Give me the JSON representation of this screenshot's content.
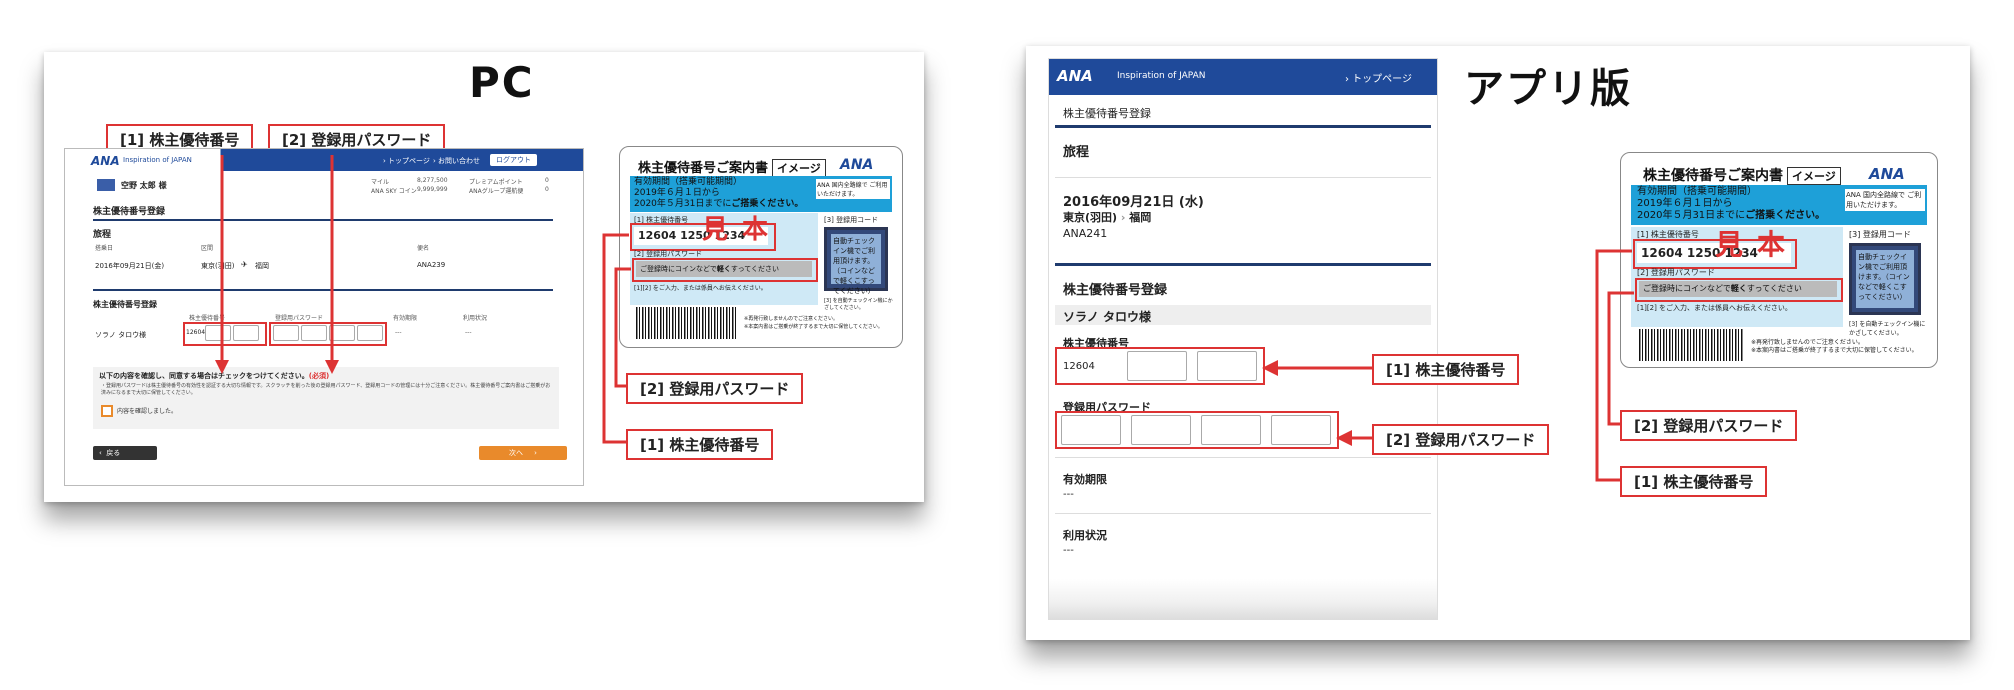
{
  "pc": {
    "title": "PC",
    "labels": {
      "label1": "[1] 株主優待番号",
      "label2": "[2] 登録用パスワード"
    },
    "screen": {
      "logo": "ANA",
      "logo_sub": "Inspiration of JAPAN",
      "nav_top": "› トップページ",
      "nav_contact": "› お問い合わせ",
      "logout": "ログアウト",
      "user_name": "空野 太郎 様",
      "miles_label": "マイル",
      "miles_value": "8,277,500",
      "premium_label": "プレミアムポイント",
      "premium_value": "0",
      "skycoin_label": "ANA SKY コイン",
      "skycoin_value": "9,999,999",
      "group_label": "ANAグループ運航便",
      "group_value": "0",
      "page_title": "株主優待番号登録",
      "itinerary_heading": "旅程",
      "col_date": "搭乗日",
      "col_route": "区間",
      "col_flight": "便名",
      "flight_date": "2016年09月21日(金)",
      "route_from": "東京(羽田)",
      "route_to": "福岡",
      "flight_no": "ANA239",
      "register_heading": "株主優待番号登録",
      "col_number": "株主優待番号",
      "col_password": "登録用パスワード",
      "col_expiry": "有効期限",
      "col_status": "利用状況",
      "passenger": "ソラノ タロウ様",
      "number_prefix": "12604",
      "expiry_value": "---",
      "status_value": "---",
      "confirm_heading": "以下の内容を確認し、同意する場合はチェックをつけてください。",
      "confirm_required": "(必須)",
      "confirm_note": "・登録用パスワードは株主優待番号の有効性を認証する大切な情報です。スクラッチを削った後の登録用パスワード、登録用コードの管理には十分ご注意ください。株主優待番号ご案内書はご搭乗がお済みになるまで大切に保管してください。",
      "confirm_check": "内容を確認しました。",
      "back_btn": "戻る",
      "next_btn": "次へ"
    }
  },
  "app": {
    "title": "アプリ版",
    "labels": {
      "label1": "[1] 株主優待番号",
      "label2": "[2] 登録用パスワード"
    },
    "screen": {
      "logo": "ANA",
      "logo_sub": "Inspiration of JAPAN",
      "nav_top": "› トップページ",
      "page_title": "株主優待番号登録",
      "itinerary_heading": "旅程",
      "flight_date": "2016年09月21日 (水)",
      "route_from": "東京(羽田)",
      "route_sep": "›",
      "route_to": "福岡",
      "flight_no": "ANA241",
      "register_heading": "株主優待番号登録",
      "passenger": "ソラノ タロウ様",
      "number_label": "株主優待番号",
      "number_prefix": "12604",
      "password_label": "登録用パスワード",
      "expiry_label": "有効期限",
      "expiry_value": "---",
      "status_label": "利用状況",
      "status_value": "---"
    }
  },
  "card": {
    "title": "株主優待番号ご案内書",
    "image_tag": "イメージ",
    "logo": "ANA",
    "validity_line1": "有効期間（搭乗可能期間）",
    "validity_line2": "2019年６月１日から",
    "validity_line3_a": "2020年５月31日までに",
    "validity_line3_b": "ご搭乗ください。",
    "domestic_note": "ANA 国内全路線で ご利用いただけます。",
    "field1_label": "[1] 株主優待番号",
    "number": "12604 1250 1234",
    "mihon": "見本",
    "field2_label": "[2] 登録用パスワード",
    "scratch_a": "ご登録時にコインなどで",
    "scratch_b": "軽く",
    "scratch_c": "すってください",
    "field3_label": "[3] 登録用コード",
    "code_note": "自動チェックイン機でご利用頂けます。（コインなどで軽くこすってください）",
    "input_note": "[1][2] をご入力、または係員へお伝えください。",
    "checkin_note": "[3] を自動チェックイン機にかざしてください。",
    "footer_note1": "※再発行致しませんのでご注意ください。",
    "footer_note2": "※本案内書はご搭乗が終了するまで大切に保管してください。"
  },
  "colors": {
    "accent_red": "#d33333",
    "ana_blue": "#1f4a9a",
    "orange": "#e98a2b"
  }
}
